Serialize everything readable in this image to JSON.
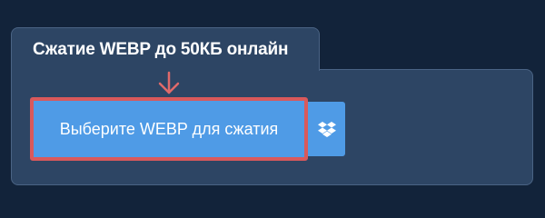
{
  "widget": {
    "title": "Сжатие WEBP до 50КБ онлайн",
    "choose_button_label": "Выберите WEBP для сжатия",
    "dropbox_icon": "dropbox-icon",
    "arrow_icon": "arrow-down-icon"
  },
  "colors": {
    "page_background": "#12233a",
    "panel_background": "#2d4564",
    "button_background": "#4f9be6",
    "highlight_border": "#d9595b",
    "arrow": "#e06a6a"
  }
}
